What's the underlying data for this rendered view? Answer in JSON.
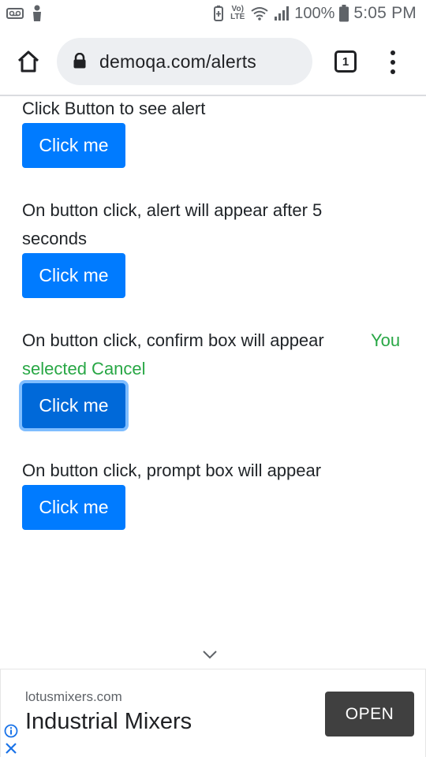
{
  "status_bar": {
    "battery_percent": "100%",
    "time": "5:05 PM",
    "volte_label": "Vo) LTE",
    "icons": [
      "voicemail-icon",
      "person-icon",
      "battery-saver-icon",
      "volte-icon",
      "wifi-icon",
      "signal-icon",
      "battery-icon"
    ]
  },
  "browser": {
    "url": "demoqa.com/alerts",
    "tab_count": "1",
    "icons": [
      "home-icon",
      "lock-icon",
      "tab-switcher-icon",
      "more-menu-icon"
    ]
  },
  "alerts": {
    "rows": [
      {
        "text": "Click Button to see alert",
        "button_label": "Click me"
      },
      {
        "text_line1": "On button click, alert will appear after 5",
        "text_line2": "seconds",
        "button_label": "Click me"
      },
      {
        "text": "On button click, confirm box will appear",
        "result_line1": "You",
        "result_line2": "selected Cancel",
        "button_label": "Click me"
      },
      {
        "text": "On button click, prompt box will appear",
        "button_label": "Click me"
      }
    ]
  },
  "ad": {
    "domain": "lotusmixers.com",
    "title": "Industrial Mixers",
    "cta": "OPEN",
    "icons": [
      "info-icon",
      "close-icon",
      "chevron-down-icon"
    ]
  },
  "colors": {
    "primary_button": "#007bff",
    "focused_button": "#0069d9",
    "success_text": "#28a745",
    "ad_button": "#404040",
    "ad_icons": "#1a73e8"
  }
}
